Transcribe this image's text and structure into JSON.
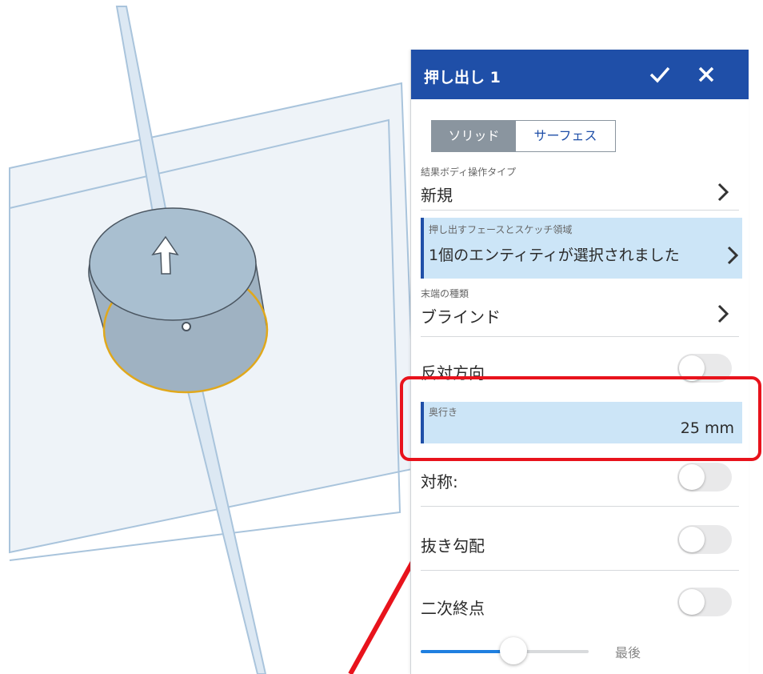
{
  "panel": {
    "title": "押し出し 1",
    "segment": {
      "solid": "ソリッド",
      "surface": "サーフェス"
    },
    "result_type": {
      "label": "結果ボディ操作タイプ",
      "value": "新規"
    },
    "faces": {
      "label": "押し出すフェースとスケッチ領域",
      "value": "1個のエンティティが選択されました"
    },
    "end_type": {
      "label": "末端の種類",
      "value": "ブラインド"
    },
    "opposite": {
      "label": "反対方向"
    },
    "depth": {
      "label": "奥行き",
      "value": "25 mm"
    },
    "symmetric": {
      "label": "対称:"
    },
    "draft": {
      "label": "抜き勾配"
    },
    "second_end": {
      "label": "二次終点"
    },
    "slider": {
      "label": "最後",
      "fraction": 0.55
    }
  },
  "colors": {
    "header": "#1f4fa8",
    "highlight": "#cce5f7",
    "annotation": "#e8131c"
  }
}
